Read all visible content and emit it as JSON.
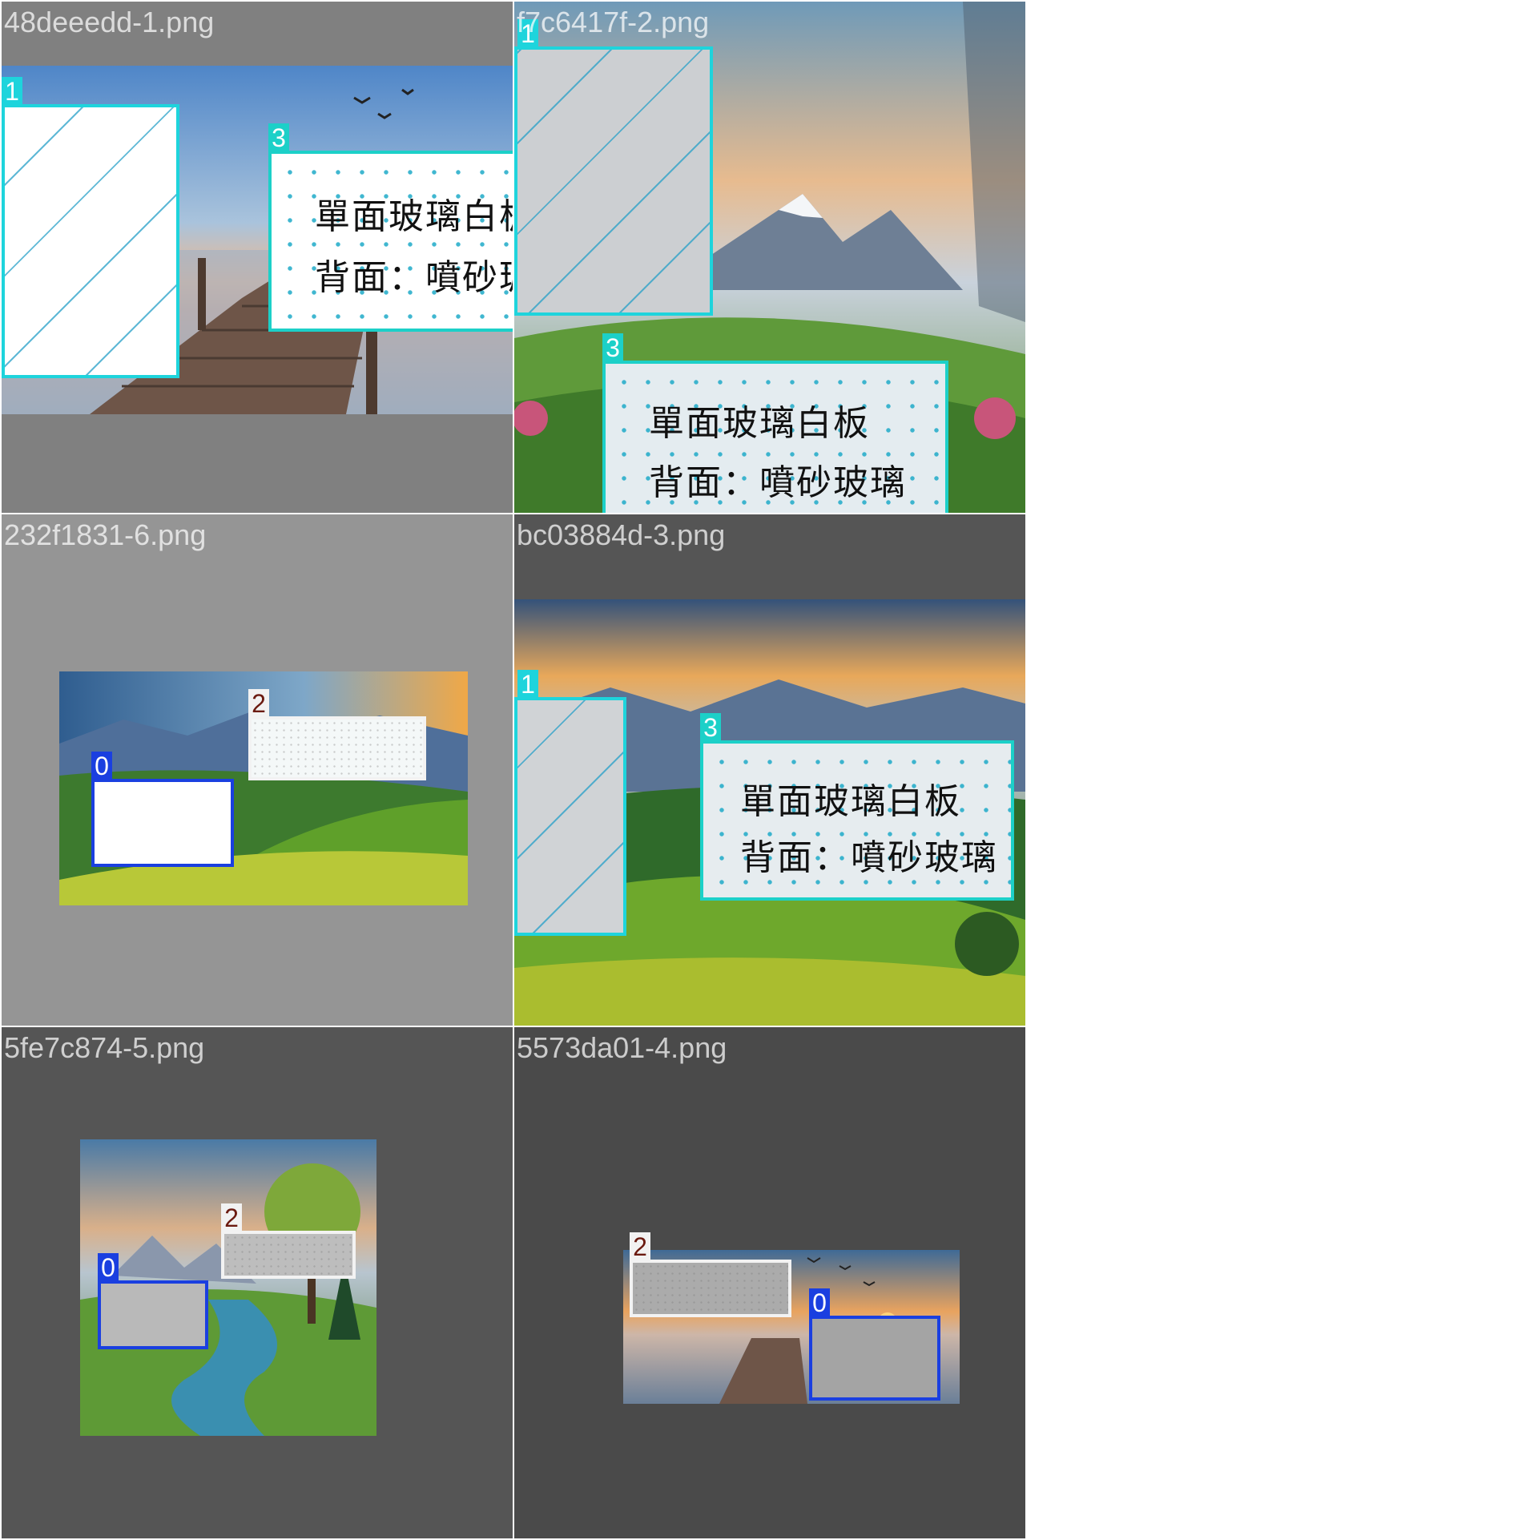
{
  "tiles": [
    {
      "filename": "48deeedd-1.png",
      "boxes": [
        {
          "label": "1"
        },
        {
          "label": "3",
          "text_line1": "單面玻璃白板",
          "text_line2": "背面：噴砂玻璃"
        }
      ]
    },
    {
      "filename": "f7c6417f-2.png",
      "boxes": [
        {
          "label": "1"
        },
        {
          "label": "3",
          "text_line1": "單面玻璃白板",
          "text_line2": "背面：噴砂玻璃"
        }
      ]
    },
    {
      "filename": "232f1831-6.png",
      "boxes": [
        {
          "label": "2"
        },
        {
          "label": "0"
        }
      ]
    },
    {
      "filename": "bc03884d-3.png",
      "boxes": [
        {
          "label": "1"
        },
        {
          "label": "3",
          "text_line1": "單面玻璃白板",
          "text_line2": "背面：噴砂玻璃"
        }
      ]
    },
    {
      "filename": "5fe7c874-5.png",
      "boxes": [
        {
          "label": "2"
        },
        {
          "label": "0"
        }
      ]
    },
    {
      "filename": "5573da01-4.png",
      "boxes": [
        {
          "label": "2"
        },
        {
          "label": "0"
        }
      ]
    }
  ],
  "colors": {
    "class_0": "#1a3fe0",
    "class_1": "#1ed4dc",
    "class_2": "#f2f2f2",
    "class_2_tag_text": "#6b1a10",
    "class_3": "#1cd0c8",
    "tile_bg_1": "#808080",
    "tile_bg_2": "#959595",
    "tile_bg_3": "#555555",
    "tile_bg_4": "#4a4a4a"
  }
}
